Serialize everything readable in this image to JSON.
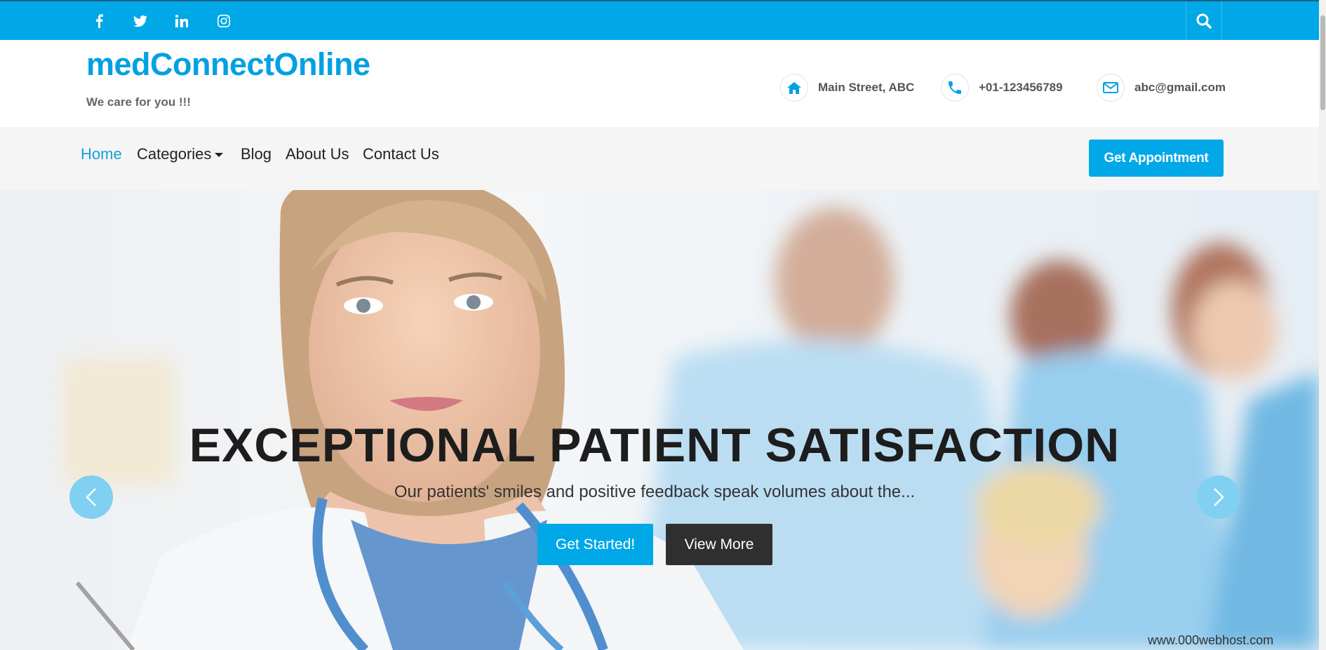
{
  "topbar": {
    "social_icons": [
      "facebook-icon",
      "twitter-icon",
      "linkedin-icon",
      "instagram-icon"
    ],
    "search_icon": "search-icon",
    "color": "#00a8e8"
  },
  "header": {
    "brand": "medConnectOnline",
    "tagline": "We care for you !!!",
    "address": "Main Street, ABC",
    "phone": "+01-123456789",
    "email": "abc@gmail.com"
  },
  "nav": {
    "items": [
      {
        "label": "Home",
        "active": true
      },
      {
        "label": "Categories",
        "has_dropdown": true
      },
      {
        "label": "Blog"
      },
      {
        "label": "About Us"
      },
      {
        "label": "Contact Us"
      }
    ],
    "cta": "Get Appointment"
  },
  "hero": {
    "title": "EXCEPTIONAL PATIENT SATISFACTION",
    "subtitle": "Our patients' smiles and positive feedback speak volumes about the...",
    "primary_button": "Get Started!",
    "secondary_button": "View More"
  },
  "footer_badge": "www.000webhost.com",
  "colors": {
    "accent": "#00a8e8",
    "dark_button": "#2f2f2f"
  }
}
